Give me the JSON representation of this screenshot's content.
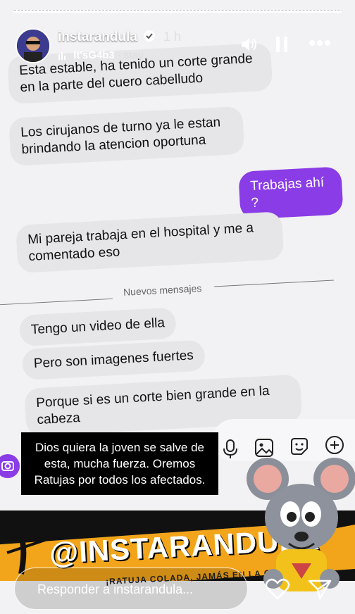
{
  "header": {
    "username": "instarandula",
    "time": "1 h",
    "music_artist": "It'sG4b3",
    "music_sep": "·",
    "music_track": "stay"
  },
  "icons": {
    "verified": "verified-badge-icon",
    "sound": "speaker-icon",
    "pause": "pause-icon",
    "more": "more-icon"
  },
  "messages": [
    {
      "text": "Esta estable, ha tenido un corte grande en la parte del cuero cabelludo",
      "from": "other"
    },
    {
      "text": "Los cirujanos de turno ya le estan brindando la atencion oportuna",
      "from": "other"
    },
    {
      "text": "Trabajas ahí ?",
      "from": "me"
    },
    {
      "text": "Mi pareja trabaja en el hospital y me a comentado eso",
      "from": "other"
    },
    {
      "text": "Tengo un video de ella",
      "from": "other"
    },
    {
      "text": "Pero son imagenes fuertes",
      "from": "other"
    },
    {
      "text": "Porque si es un corte bien grande en la cabeza",
      "from": "other"
    }
  ],
  "divider": "Nuevos mensajes",
  "caption": "Dios quiera la joven se salve de esta, mucha fuerza. Oremos Ratujas por todos los afectados.",
  "banner": {
    "title": "@INSTARANDULA",
    "subtitle": "¡RATUJA COLADA, JAMÁS EN LA COLA!"
  },
  "reply": {
    "placeholder": "Responder a instarandula..."
  },
  "colors": {
    "accent": "#8a3ce6",
    "bubble": "#e6e6e8",
    "banner": "#f2a51a"
  }
}
